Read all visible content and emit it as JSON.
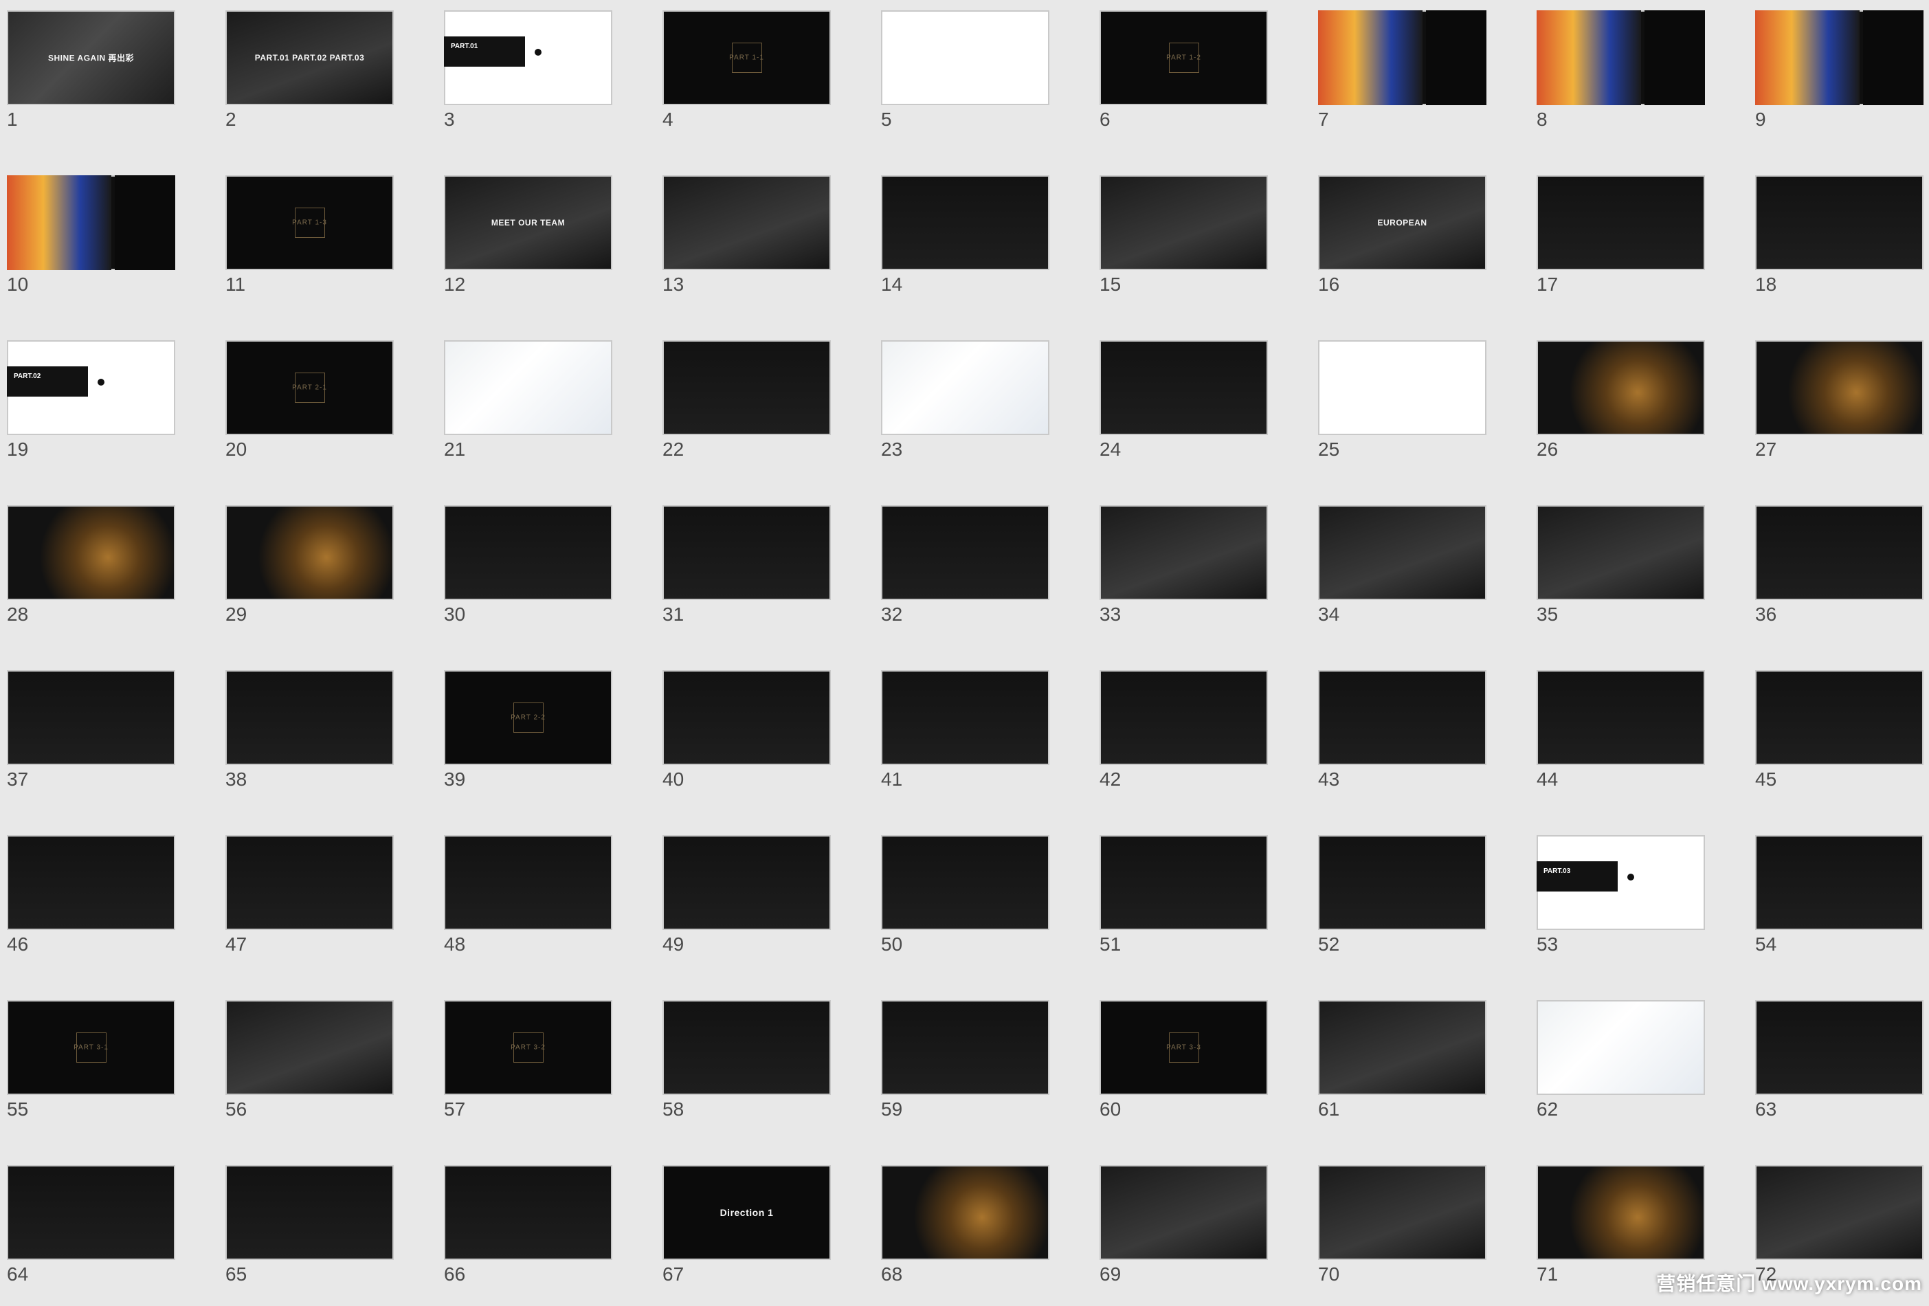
{
  "slides": [
    {
      "n": "1",
      "kind": "photo",
      "text": "SHINE AGAIN 再出彩"
    },
    {
      "n": "2",
      "kind": "photo2",
      "text": "PART.01 PART.02 PART.03"
    },
    {
      "n": "3",
      "kind": "part",
      "text": "PART.01"
    },
    {
      "n": "4",
      "kind": "frame",
      "text": "PART 1-1"
    },
    {
      "n": "5",
      "kind": "white",
      "text": ""
    },
    {
      "n": "6",
      "kind": "frame",
      "text": "PART 1-2"
    },
    {
      "n": "7",
      "kind": "poster",
      "text": ""
    },
    {
      "n": "8",
      "kind": "poster",
      "text": ""
    },
    {
      "n": "9",
      "kind": "poster",
      "text": ""
    },
    {
      "n": "10",
      "kind": "poster",
      "text": ""
    },
    {
      "n": "11",
      "kind": "frame",
      "text": "PART 1-3"
    },
    {
      "n": "12",
      "kind": "photo2",
      "text": "MEET OUR TEAM"
    },
    {
      "n": "13",
      "kind": "photo2",
      "text": ""
    },
    {
      "n": "14",
      "kind": "dark2",
      "text": ""
    },
    {
      "n": "15",
      "kind": "photo2",
      "text": ""
    },
    {
      "n": "16",
      "kind": "photo2",
      "text": "EUROPEAN"
    },
    {
      "n": "17",
      "kind": "dark2",
      "text": ""
    },
    {
      "n": "18",
      "kind": "dark2",
      "text": ""
    },
    {
      "n": "19",
      "kind": "part",
      "text": "PART.02"
    },
    {
      "n": "20",
      "kind": "frame",
      "text": "PART 2-1"
    },
    {
      "n": "21",
      "kind": "map",
      "text": ""
    },
    {
      "n": "22",
      "kind": "dark2",
      "text": ""
    },
    {
      "n": "23",
      "kind": "map",
      "text": ""
    },
    {
      "n": "24",
      "kind": "dark2",
      "text": ""
    },
    {
      "n": "25",
      "kind": "white",
      "text": ""
    },
    {
      "n": "26",
      "kind": "gold",
      "text": ""
    },
    {
      "n": "27",
      "kind": "gold",
      "text": ""
    },
    {
      "n": "28",
      "kind": "gold",
      "text": ""
    },
    {
      "n": "29",
      "kind": "gold",
      "text": ""
    },
    {
      "n": "30",
      "kind": "dark2",
      "text": ""
    },
    {
      "n": "31",
      "kind": "dark2",
      "text": ""
    },
    {
      "n": "32",
      "kind": "dark2",
      "text": ""
    },
    {
      "n": "33",
      "kind": "photo2",
      "text": ""
    },
    {
      "n": "34",
      "kind": "photo2",
      "text": ""
    },
    {
      "n": "35",
      "kind": "photo2",
      "text": ""
    },
    {
      "n": "36",
      "kind": "dark2",
      "text": ""
    },
    {
      "n": "37",
      "kind": "dark2",
      "text": ""
    },
    {
      "n": "38",
      "kind": "dark2",
      "text": ""
    },
    {
      "n": "39",
      "kind": "frame",
      "text": "PART 2-2"
    },
    {
      "n": "40",
      "kind": "dark2",
      "text": ""
    },
    {
      "n": "41",
      "kind": "dark2",
      "text": ""
    },
    {
      "n": "42",
      "kind": "dark2",
      "text": ""
    },
    {
      "n": "43",
      "kind": "dark2",
      "text": ""
    },
    {
      "n": "44",
      "kind": "dark2",
      "text": ""
    },
    {
      "n": "45",
      "kind": "dark2",
      "text": ""
    },
    {
      "n": "46",
      "kind": "dark2",
      "text": ""
    },
    {
      "n": "47",
      "kind": "dark2",
      "text": ""
    },
    {
      "n": "48",
      "kind": "dark2",
      "text": ""
    },
    {
      "n": "49",
      "kind": "dark2",
      "text": ""
    },
    {
      "n": "50",
      "kind": "dark2",
      "text": ""
    },
    {
      "n": "51",
      "kind": "dark2",
      "text": ""
    },
    {
      "n": "52",
      "kind": "dark2",
      "text": ""
    },
    {
      "n": "53",
      "kind": "part",
      "text": "PART.03"
    },
    {
      "n": "54",
      "kind": "dark2",
      "text": ""
    },
    {
      "n": "55",
      "kind": "frame",
      "text": "PART 3-1"
    },
    {
      "n": "56",
      "kind": "photo2",
      "text": ""
    },
    {
      "n": "57",
      "kind": "frame",
      "text": "PART 3-2"
    },
    {
      "n": "58",
      "kind": "dark2",
      "text": ""
    },
    {
      "n": "59",
      "kind": "dark2",
      "text": ""
    },
    {
      "n": "60",
      "kind": "frame",
      "text": "PART 3-3"
    },
    {
      "n": "61",
      "kind": "photo2",
      "text": ""
    },
    {
      "n": "62",
      "kind": "map",
      "text": ""
    },
    {
      "n": "63",
      "kind": "dark2",
      "text": ""
    },
    {
      "n": "64",
      "kind": "dark2",
      "text": ""
    },
    {
      "n": "65",
      "kind": "dark2",
      "text": ""
    },
    {
      "n": "66",
      "kind": "dark2",
      "text": ""
    },
    {
      "n": "67",
      "kind": "direction",
      "text": "Direction 1"
    },
    {
      "n": "68",
      "kind": "gold",
      "text": ""
    },
    {
      "n": "69",
      "kind": "photo2",
      "text": ""
    },
    {
      "n": "70",
      "kind": "photo2",
      "text": ""
    },
    {
      "n": "71",
      "kind": "gold",
      "text": ""
    },
    {
      "n": "72",
      "kind": "photo2",
      "text": ""
    }
  ],
  "watermark": "营销任意门 www.yxrym.com"
}
